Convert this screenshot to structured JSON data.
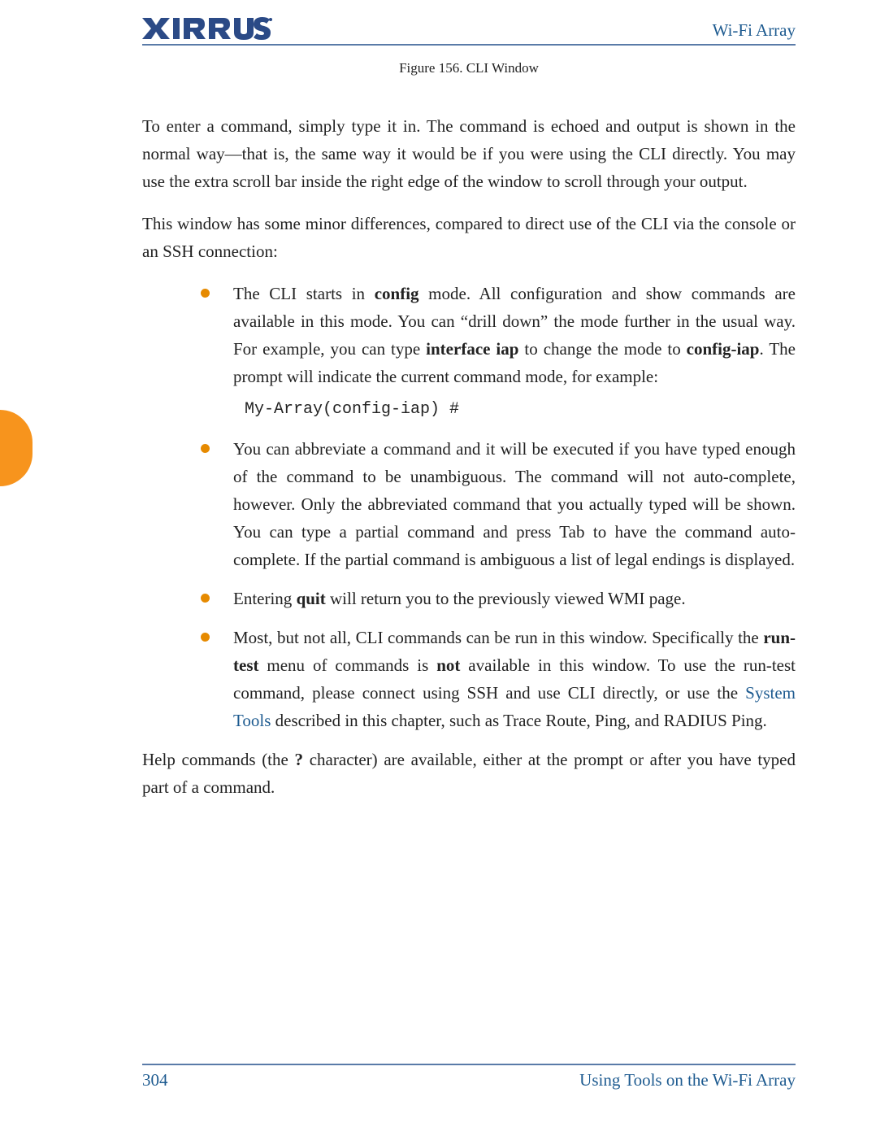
{
  "header": {
    "logo_text": "XIRRUS",
    "title": "Wi-Fi Array"
  },
  "figure_caption": "Figure 156. CLI Window",
  "paragraphs": {
    "p1": "To enter a command, simply type it in. The command is echoed and output is shown in the normal way—that is, the same way it would be if you were using the CLI directly. You may use the extra scroll bar inside the right edge of the window to scroll through your output.",
    "p2": "This window has some minor differences, compared to direct use of the CLI via the console or an SSH connection:",
    "p3_a": "Help commands (the ",
    "p3_b": "?",
    "p3_c": " character) are available, either at the prompt or after you have typed part of a command."
  },
  "bullets": {
    "b1": {
      "a": "The CLI starts in ",
      "b": "config",
      "c": " mode. All configuration and show commands are available in this mode. You can “drill down” the mode further in the usual way. For example, you can type ",
      "d": "interface iap",
      "e": " to change the mode to ",
      "f": "config-iap",
      "g": ". The prompt will indicate the current command mode, for example:",
      "code": "My-Array(config-iap) #"
    },
    "b2": "You can abbreviate a command and it will be executed if you have typed enough of the command to be unambiguous. The command will not auto-complete, however. Only the abbreviated command that you actually typed will be shown. You can type a partial command and press Tab to have the command auto-complete. If the partial command is ambiguous a list of legal endings is displayed.",
    "b3": {
      "a": "Entering ",
      "b": "quit",
      "c": " will return you to the previously viewed WMI page."
    },
    "b4": {
      "a": "Most, but not all, CLI commands can be run in this window. Specifically the ",
      "b": "run-test",
      "c": " menu of commands is ",
      "d": "not",
      "e": " available in this window. To use the run-test command, please connect using SSH and use CLI directly, or use the ",
      "f": "System Tools",
      "g": " described in this chapter, such as Trace Route, Ping, and RADIUS Ping."
    }
  },
  "footer": {
    "page": "304",
    "section": "Using Tools on the Wi-Fi Array"
  }
}
